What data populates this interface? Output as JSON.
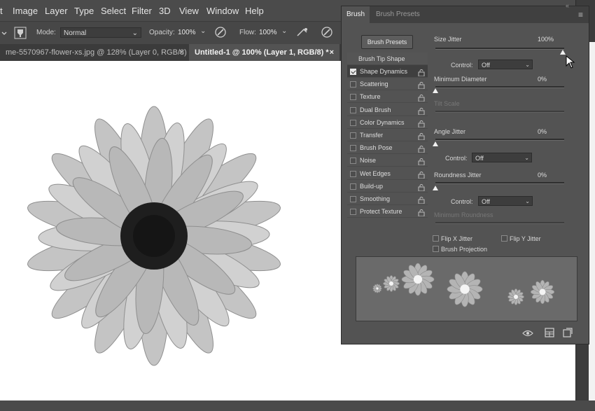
{
  "menubar": {
    "items": [
      "t",
      "Image",
      "Layer",
      "Type",
      "Select",
      "Filter",
      "3D",
      "View",
      "Window",
      "Help"
    ]
  },
  "options_bar": {
    "mode_label": "Mode:",
    "mode_value": "Normal",
    "opacity_label": "Opacity:",
    "opacity_value": "100%",
    "flow_label": "Flow:",
    "flow_value": "100%"
  },
  "doc_tabs": [
    {
      "label": "me-5570967-flower-xs.jpg @ 128% (Layer 0, RGB/8) *",
      "close": "×"
    },
    {
      "label": "Untitled-1 @ 100% (Layer 1, RGB/8) *",
      "close": "×"
    }
  ],
  "brush_panel": {
    "tabs": [
      "Brush",
      "Brush Presets"
    ],
    "presets_button": "Brush Presets",
    "list_header": "Brush Tip Shape",
    "options": [
      {
        "label": "Shape Dynamics",
        "checked": true,
        "selected": true
      },
      {
        "label": "Scattering",
        "checked": false
      },
      {
        "label": "Texture",
        "checked": false
      },
      {
        "label": "Dual Brush",
        "checked": false
      },
      {
        "label": "Color Dynamics",
        "checked": false
      },
      {
        "label": "Transfer",
        "checked": false
      },
      {
        "label": "Brush Pose",
        "checked": false
      },
      {
        "label": "Noise",
        "checked": false
      },
      {
        "label": "Wet Edges",
        "checked": false
      },
      {
        "label": "Build-up",
        "checked": false
      },
      {
        "label": "Smoothing",
        "checked": false
      },
      {
        "label": "Protect Texture",
        "checked": false
      }
    ],
    "size_jitter": {
      "label": "Size Jitter",
      "value": "100%",
      "level": 1.0
    },
    "control1": {
      "label": "Control:",
      "value": "Off"
    },
    "min_diameter": {
      "label": "Minimum Diameter",
      "value": "0%",
      "level": 0.0
    },
    "tilt_scale": {
      "label": "Tilt Scale"
    },
    "angle_jitter": {
      "label": "Angle Jitter",
      "value": "0%",
      "level": 0.0
    },
    "control2": {
      "label": "Control:",
      "value": "Off"
    },
    "roundness_jitter": {
      "label": "Roundness Jitter",
      "value": "0%",
      "level": 0.0
    },
    "control3": {
      "label": "Control:",
      "value": "Off"
    },
    "min_roundness": {
      "label": "Minimum Roundness"
    },
    "flip_x": "Flip X Jitter",
    "flip_y": "Flip Y Jitter",
    "brush_projection": "Brush Projection"
  },
  "colors": {
    "panel_bg": "#535353",
    "canvas_bg": "#ffffff",
    "preview_bg": "#6a6a6a"
  }
}
